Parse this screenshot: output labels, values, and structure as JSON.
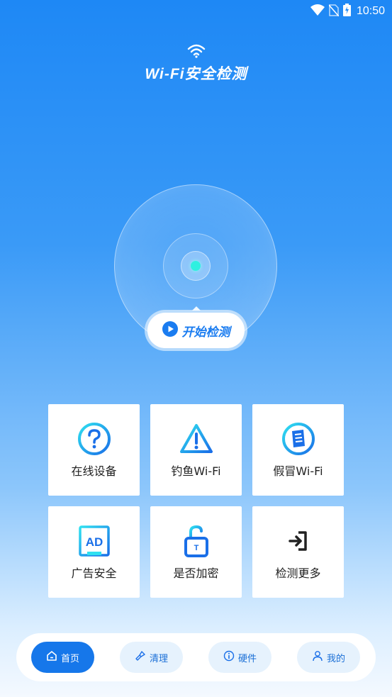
{
  "status": {
    "time": "10:50"
  },
  "header": {
    "title": "Wi-Fi安全检测"
  },
  "start": {
    "label": "开始检测"
  },
  "grid": {
    "items": [
      {
        "label": "在线设备",
        "icon": "question-icon"
      },
      {
        "label": "钓鱼Wi-Fi",
        "icon": "warning-icon"
      },
      {
        "label": "假冒Wi-Fi",
        "icon": "document-icon"
      },
      {
        "label": "广告安全",
        "icon": "ad-icon"
      },
      {
        "label": "是否加密",
        "icon": "lock-icon"
      },
      {
        "label": "检测更多",
        "icon": "enter-icon"
      }
    ]
  },
  "nav": {
    "items": [
      {
        "label": "首页",
        "icon": "home-icon",
        "active": true
      },
      {
        "label": "清理",
        "icon": "broom-icon",
        "active": false
      },
      {
        "label": "硬件",
        "icon": "info-icon",
        "active": false
      },
      {
        "label": "我的",
        "icon": "user-icon",
        "active": false
      }
    ]
  },
  "colors": {
    "accent": "#1677ea",
    "cyan": "#2ff0e0",
    "tile_bg": "#ffffff"
  }
}
